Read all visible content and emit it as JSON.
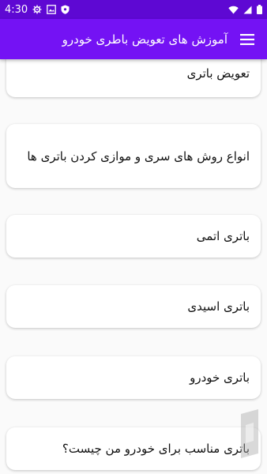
{
  "status": {
    "time": "4:30"
  },
  "appbar": {
    "title": "آموزش های تعویض باطری خودرو",
    "menu_icon": "hamburger-menu-icon"
  },
  "colors": {
    "status_bar": "#5e08d3",
    "app_bar": "#7412f4",
    "background": "#fafafa"
  },
  "items": [
    {
      "label": "تعویض باتری"
    },
    {
      "label": "انواع روش های سری و موازی کردن باتری ها"
    },
    {
      "label": "باتری اتمی"
    },
    {
      "label": "باتری اسیدی"
    },
    {
      "label": "باتری خودرو"
    },
    {
      "label": "باتری مناسب برای خودرو من چیست؟"
    }
  ]
}
